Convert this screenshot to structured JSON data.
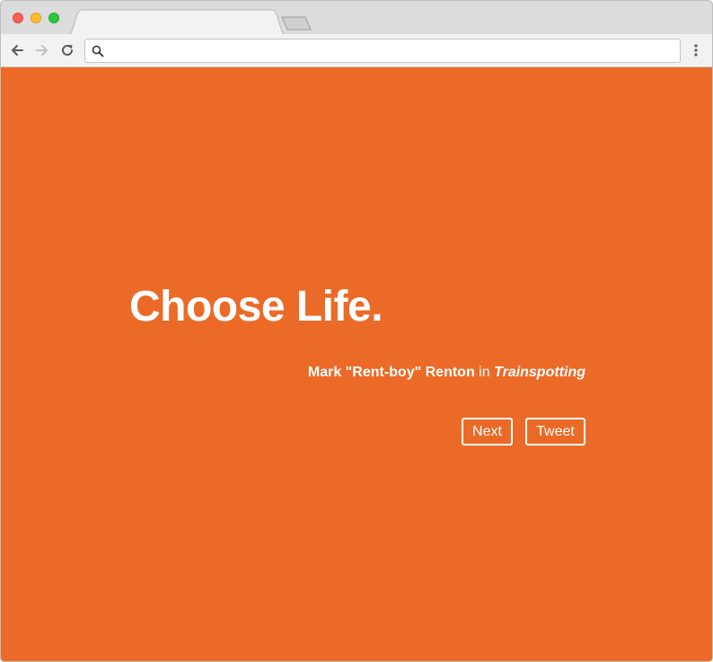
{
  "browser": {
    "tab_title": "",
    "address": "",
    "address_placeholder": ""
  },
  "quote": {
    "text": "Choose Life.",
    "speaker": "Mark \"Rent-boy\" Renton",
    "connector": "in",
    "film": "Trainspotting"
  },
  "actions": {
    "next_label": "Next",
    "tweet_label": "Tweet"
  },
  "colors": {
    "background": "#ec6a27",
    "text": "#ffffff"
  },
  "icons": {
    "back": "arrow-left-icon",
    "forward": "arrow-right-icon",
    "reload": "reload-icon",
    "search": "search-icon",
    "menu": "more-vertical-icon"
  }
}
